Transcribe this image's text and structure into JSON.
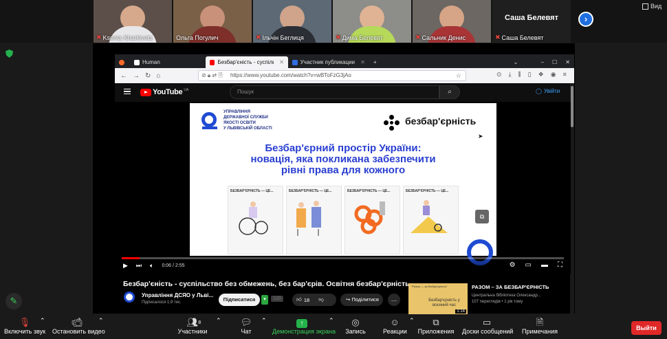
{
  "gallery": {
    "participants": [
      {
        "name": "Ksenia Kharkivets"
      },
      {
        "name": "Ольга Погулич"
      },
      {
        "name": "Ільчін Беглиця"
      },
      {
        "name": "Дима Белевят"
      },
      {
        "name": "Сальник Денис"
      },
      {
        "name": "Саша Белевят",
        "big_name": "Саша Белевят"
      }
    ],
    "view_label": "Вид"
  },
  "browser": {
    "tabs": [
      {
        "label": "Human"
      },
      {
        "label": "Безбар'єність - суспільс"
      },
      {
        "label": "Участник публикации -"
      }
    ],
    "url": "https://www.youtube.com/watch?v=wBToFzG3jAo"
  },
  "youtube": {
    "logo_text": "YouTube",
    "logo_region": "UA",
    "search_placeholder": "Пошук",
    "signin_label": "Увійти",
    "time": "0:06 / 2:55",
    "progress_fraction": 0.04,
    "video_title": "Безбар'єність - суспільство без обмежень, без бар'єрів. Освітня безбар'єрність",
    "channel_name": "Управління ДСЯО у Льві...",
    "channel_subs": "Підписалося 1,9 тис.",
    "subscribe_label": "Підписатися",
    "sub_count": "120",
    "likes": "18",
    "share_label": "Поділитися",
    "slide": {
      "org_lines": [
        "Управління",
        "державної служби",
        "якості освіти",
        "у Львівській області"
      ],
      "brand": "безбар'єрність",
      "headline": [
        "Безбар'єрний простір України:",
        "новація, яка покликана забезпечити",
        "рівні права для кожного"
      ],
      "panel_titles": [
        "БЕЗБАР'ЄРНІСТЬ — ЦЕ...",
        "БЕЗБАР'ЄРНІСТЬ — ЦЕ...",
        "БЕЗБАР'ЄРНІСТЬ — ЦЕ...",
        "БЕЗБАР'ЄРНІСТЬ — ЦЕ..."
      ]
    },
    "recommendation": {
      "title": "РАЗОМ – ЗА БЕЗБАР'ЄРНІСТЬ",
      "channel": "Центральна бібліотека Олександр...",
      "meta": "107 переглядів • 1 рік тому",
      "thumb_top": "\"Разом — за безбар'єрність\"",
      "thumb_text": "Безбар'єрність у воєнний час",
      "duration": "1:14"
    }
  },
  "toolbar": {
    "mute_label": "Включить звук",
    "video_label": "Остановить видео",
    "participants_label": "Участники",
    "participants_count": "8",
    "chat_label": "Чат",
    "share_label": "Демонстрация экрана",
    "record_label": "Запись",
    "reactions_label": "Реакции",
    "apps_label": "Приложения",
    "whiteboard_label": "Доски сообщений",
    "notes_label": "Примечания",
    "leave_label": "Выйти"
  },
  "colors": {
    "zoom_green": "#24b34a",
    "leave_red": "#e02828",
    "youtube_red": "#ff0000",
    "brand_blue": "#1f4bd3"
  }
}
